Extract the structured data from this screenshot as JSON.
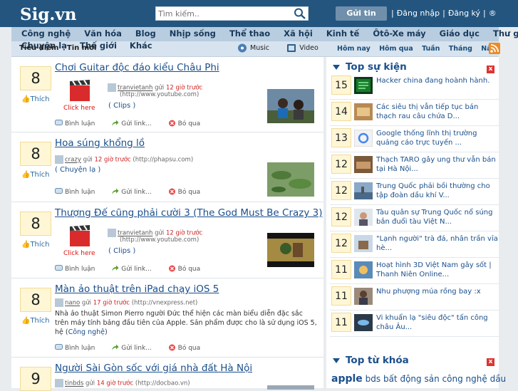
{
  "header": {
    "logo": "Sig.vn",
    "search_placeholder": "Tìm kiếm..",
    "post_button": "Gửi tin",
    "login": "Đăng nhập",
    "register": "Đăng ký",
    "extra": "®"
  },
  "categories": [
    "Công nghệ",
    "Văn hóa",
    "Blog",
    "Nhịp sống",
    "Thể thao",
    "Xã hội",
    "Kinh tế",
    "Ôtô-Xe máy",
    "Giáo dục",
    "Thư giãn"
  ],
  "categories2": [
    "Chuyện lạ",
    "Thế giới",
    "Khác"
  ],
  "tabs": [
    "Tiêu điểm",
    "Tin mới"
  ],
  "media": {
    "music": "Music",
    "video": "Video"
  },
  "timenav": [
    "Hôm nay",
    "Hôm qua",
    "Tuần",
    "Tháng",
    "Năm"
  ],
  "stories": [
    {
      "votes": "8",
      "like": "Thích",
      "title": "Chơi Guitar độc đáo kiểu Châu Phi",
      "clip_label": "Click here",
      "user": "tranvietanh",
      "sent": "gửi",
      "time": "12 giờ trước",
      "source": "(http://www.youtube.com)",
      "tag": "( Clips )",
      "comment": "Bình luận",
      "share": "Gửi link...",
      "skip": "Bỏ qua"
    },
    {
      "votes": "8",
      "like": "Thích",
      "title": "Hoa súng khổng lồ",
      "user": "crazy",
      "sent": "gửi",
      "time": "12 giờ trước",
      "source": "(http://phapsu.com)",
      "tag": "( Chuyện lạ )",
      "comment": "Bình luận",
      "share": "Gửi link...",
      "skip": "Bỏ qua"
    },
    {
      "votes": "8",
      "like": "Thích",
      "title": "Thượng Đế cũng phải cười 3 (The God Must Be Crazy 3)",
      "clip_label": "Click here",
      "user": "tranvietanh",
      "sent": "gửi",
      "time": "12 giờ trước",
      "source": "(http://www.youtube.com)",
      "tag": "( Clips )",
      "comment": "Bình luận",
      "share": "Gửi link...",
      "skip": "Bỏ qua"
    },
    {
      "votes": "8",
      "like": "Thích",
      "title": "Màn ảo thuật trên iPad chạy iOS 5",
      "user": "nano",
      "sent": "gửi",
      "time": "17 giờ trước",
      "source": "(http://vnexpress.net)",
      "desc": "Nhà ảo thuật Simon Pierro người Đức thể hiện các màn biểu diễn đặc sắc trên máy tính bảng đầu tiên của Apple. Sản phẩm được cho là sử dụng iOS 5, hệ (",
      "tag": "Công nghệ",
      "tag_close": ")",
      "comment": "Bình luận",
      "share": "Gửi link...",
      "skip": "Bỏ qua"
    },
    {
      "votes": "9",
      "title": "Người Sài Gòn sốc với giá nhà đất Hà Nội",
      "user": "tinbds",
      "sent": "gửi",
      "time": "14 giờ trước",
      "source": "(http://docbao.vn)"
    }
  ],
  "top_events": {
    "title": "Top sự kiện",
    "close": "x",
    "items": [
      {
        "num": "15",
        "text": "Hacker china đang hoành hành."
      },
      {
        "num": "14",
        "text": "Các siêu thị vẫn tiếp tục bán thạch rau câu chứa D..."
      },
      {
        "num": "13",
        "text": "Google thống lĩnh thị trường quảng cáo trực tuyến ..."
      },
      {
        "num": "12",
        "text": "Thạch TARO gây ung thư vẫn bán tại Hà Nội..."
      },
      {
        "num": "12",
        "text": "Trung Quốc phải bồi thường cho tập đoàn dầu khí V..."
      },
      {
        "num": "12",
        "text": "Tàu quân sự Trung Quốc nổ súng bắn đuổi tàu Việt N..."
      },
      {
        "num": "12",
        "text": "\"Lạnh người\" trà đá, nhân trần vỉa hè..."
      },
      {
        "num": "11",
        "text": "Hoạt hình 3D Việt Nam gây sốt | Thanh Niên Online..."
      },
      {
        "num": "11",
        "text": "Nhu phượng múa rồng bay :x"
      },
      {
        "num": "11",
        "text": "Vi khuẩn lạ \"siêu độc\" tấn công châu Âu..."
      }
    ]
  },
  "top_keywords": {
    "title": "Top từ khóa",
    "close": "x",
    "items": [
      "apple",
      "bds",
      "bất",
      "động",
      "sản",
      "công",
      "nghệ",
      "dầu"
    ]
  },
  "colors": {
    "header": "#23557f",
    "link": "#1a4f8c",
    "vote_bg": "#fff6d6",
    "accent_red": "#cc2222"
  }
}
